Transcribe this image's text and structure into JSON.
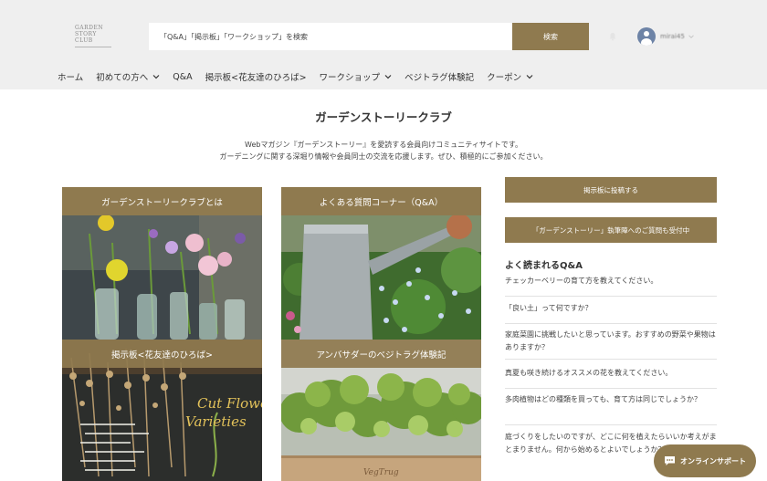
{
  "header": {
    "logo": [
      "GARDEN",
      "STORY",
      "CLUB"
    ],
    "search": {
      "value": "「Q&A」「掲示板」「ワークショップ」を検索",
      "button_label": "検索"
    },
    "account": {
      "name": "mirai45"
    }
  },
  "nav": {
    "items": [
      {
        "label": "ホーム",
        "dropdown": false
      },
      {
        "label": "初めての方へ",
        "dropdown": true
      },
      {
        "label": "Q&A",
        "dropdown": false
      },
      {
        "label": "掲示板<花友達のひろば>",
        "dropdown": false
      },
      {
        "label": "ワークショップ",
        "dropdown": true
      },
      {
        "label": "ベジトラグ体験記",
        "dropdown": false
      },
      {
        "label": "クーポン",
        "dropdown": true
      }
    ]
  },
  "main": {
    "title": "ガーデンストーリークラブ",
    "intro": [
      "Webマガジン『ガーデンストーリー』を愛読する会員向けコミュニティサイトです。",
      "ガーデニングに関する深堀り情報や会員同士の交流を応援します。ぜひ、積極的にご参加ください。"
    ]
  },
  "cards": {
    "about": "ガーデンストーリークラブとは",
    "faq": "よくある質問コーナー（Q&A）",
    "board": "掲示板<花友達のひろば>",
    "vegtrug": "アンバサダーのベジトラグ体験記",
    "chalkboard_text": [
      "Cut Flower",
      "Varieties"
    ],
    "planter_text": "VegTrug"
  },
  "sidebar": {
    "post_button": "掲示板に投稿する",
    "question_button": "「ガーデンストーリー」執筆陣へのご質問も受付中",
    "faq_heading": "よく読まれるQ&A",
    "faq_items": [
      "チェッカーベリーの育て方を教えてください。",
      "「良い土」って何ですか？",
      "家庭菜園に挑戦したいと思っています。おすすめの野菜や果物はありますか？",
      "真夏も咲き続けるオススメの花を教えてください。",
      "多肉植物はどの種類を買っても、育て方は同じでしょうか？",
      "庭づくりをしたいのですが、どこに何を植えたらいいか考えがまとまりません。何から始めるとよいでしょうか？"
    ]
  },
  "support": {
    "label": "オンラインサポート"
  },
  "colors": {
    "accent": "#8f7a4f",
    "header_bg": "#efefef"
  }
}
